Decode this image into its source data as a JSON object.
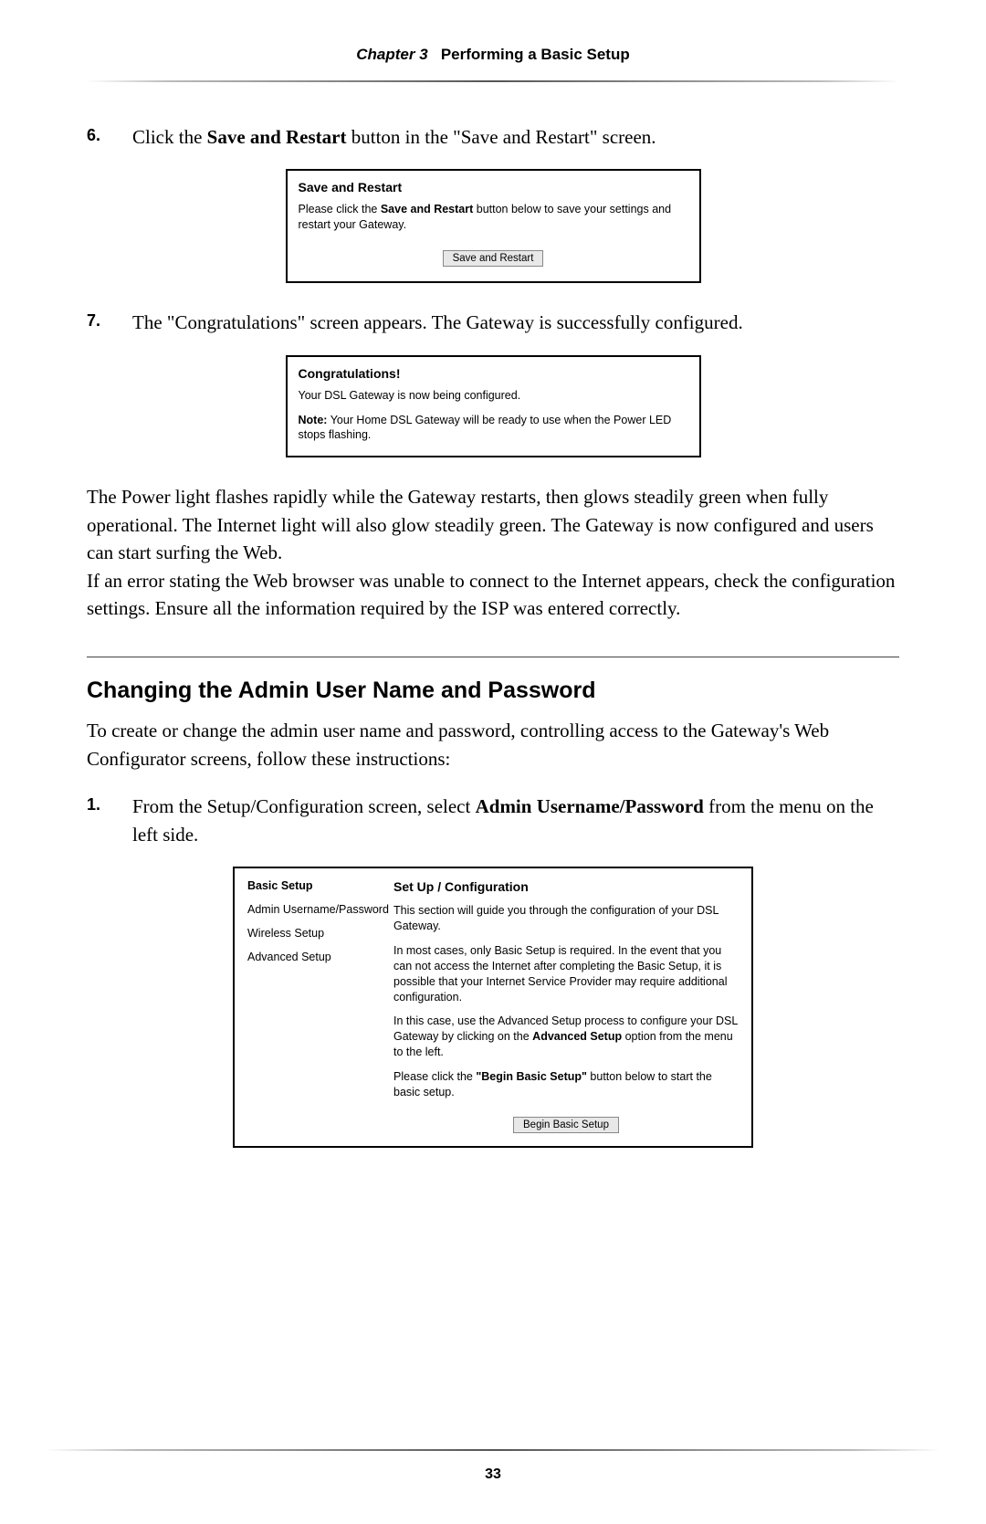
{
  "header": {
    "chapter_label": "Chapter 3",
    "chapter_title": "Performing a Basic Setup"
  },
  "step6": {
    "number": "6.",
    "text_before": "Click the ",
    "bold": "Save and Restart",
    "text_after": " button in the \"Save and Restart\" screen."
  },
  "screenshot1": {
    "title": "Save and Restart",
    "text_before": "Please click the ",
    "bold": "Save and Restart",
    "text_after": " button below to save your settings and restart your Gateway.",
    "button": "Save and Restart"
  },
  "step7": {
    "number": "7.",
    "text": "The \"Congratulations\" screen appears. The Gateway is successfully configured."
  },
  "screenshot2": {
    "title": "Congratulations!",
    "line1": "Your DSL Gateway is now being configured.",
    "note_label": "Note:",
    "note_text": " Your Home DSL Gateway will be ready to use when the Power LED stops flashing."
  },
  "para1": "The Power light flashes rapidly while the Gateway restarts, then glows steadily green when fully operational. The Internet light will also glow steadily green. The Gateway is now configured and users can start surfing the Web.",
  "para2_a": "If an error stating the Web browser was unable to connect to the Internet appears, check the configuration settings. Ensure all the information required by the ",
  "para2_isp": "ISP",
  "para2_b": " was entered correctly.",
  "section_heading": "Changing the Admin User Name and Password",
  "section_intro": "To create or change the admin user name and password, controlling access to the Gateway's Web Configurator screens, follow these instructions:",
  "step1": {
    "number": "1.",
    "a": "From the Setup/Configuration screen, select ",
    "bold": "Admin Username/Password",
    "b": " from the menu on the left side."
  },
  "screenshot3": {
    "menu": {
      "item0": "Basic Setup",
      "item1": "Admin Username/Password",
      "item2": "Wireless Setup",
      "item3": "Advanced Setup"
    },
    "title": "Set Up / Configuration",
    "p1": "This section will guide you through the configuration of your DSL Gateway.",
    "p2": "In most cases, only Basic Setup is required. In the event that you can not access the Internet after completing the Basic Setup, it is possible that your Internet Service Provider may require additional configuration.",
    "p3_a": "In this case, use the Advanced Setup process to configure your DSL Gateway by clicking on the ",
    "p3_bold": "Advanced Setup",
    "p3_b": " option from the menu to the left.",
    "p4_a": "Please click the ",
    "p4_bold": "\"Begin Basic Setup\"",
    "p4_b": " button below to start the basic setup.",
    "button": "Begin Basic Setup"
  },
  "page_number": "33"
}
